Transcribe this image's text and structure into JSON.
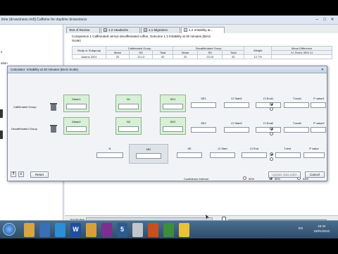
{
  "window": {
    "title": "time (drowsiness.rm5] Caffeine for daytime drowsiness"
  },
  "tree": {
    "items": [
      "",
      "",
      "",
      "s",
      "",
      "ation",
      "",
      "",
      "",
      "",
      "",
      "",
      "",
      "",
      "",
      "",
      "",
      "",
      "",
      "",
      "",
      ""
    ]
  },
  "tabs": [
    {
      "label": "Text of Review"
    },
    {
      "label": "1.2 Headache"
    },
    {
      "label": "1.1 Migraines"
    },
    {
      "label": "1.2 Irritability at..."
    }
  ],
  "background": {
    "comparison": "Comparison 1 Caffeinated versus decaffeinated coffee, Outcome 1.3 Irritability at 30 minutes (BIAS Scale)",
    "table_headers": {
      "study": "Study or Subgroup",
      "caff": "Caffeinated Group",
      "decaff": "Decaffeinated Group",
      "weight": "Weight",
      "md": "Mean Difference",
      "md_sub": "IV, Fixed, 95% CI",
      "mean": "Mean",
      "sd": "SD",
      "total": "Total"
    },
    "first_row": {
      "study": "Adams 2001",
      "mean1": "20",
      "sd1": "13.13",
      "mean2": "20",
      "sd2": "23.24",
      "total": "40",
      "weight": "12.7%"
    },
    "footnotes_label": "Footnotes"
  },
  "dialog": {
    "title": "Calculator: Irritability at 30 minutes (BIAS Scale)",
    "caffeinated_group": "Caffeinated Group",
    "decaffeinated_group": "Decaffeinated Group",
    "col_mean1": "Mean1",
    "col_n1": "N1",
    "col_sd1": "SD1",
    "col_mean2": "Mean2",
    "col_n2": "N2",
    "col_sd2": "SD2",
    "se1": "SE1",
    "ci_start1": "CI Start1",
    "ci_end1": "CI End1",
    "t_test1": "T-test1",
    "p_value1": "P value1",
    "se2": "SE2",
    "ci_start2": "CI Start2",
    "ci_end2": "CI End2",
    "t_test2": "T-test2",
    "p_value2": "P value2",
    "n": "N",
    "md": "MD",
    "se": "SE",
    "ci_start": "CI Start",
    "ci_end": "CI End",
    "t_test": "T-test",
    "p_value": "P value",
    "confidence_label": "Confidence Interval:",
    "conf_options": [
      "90%",
      "95%",
      "99%"
    ],
    "conf_selected": "95%",
    "reset_button": "Reset",
    "update_button": "Update data table",
    "cancel_button": "Cancel",
    "help_icon": "?",
    "calc_icon": "≡"
  },
  "taskbar": {
    "icons": [
      "explorer-icon",
      "media-icon",
      "ie-icon",
      "word-icon",
      "outlook-icon",
      "revman-icon",
      "app5-icon",
      "app-icon",
      "excel-icon",
      "app-icon",
      "app-icon"
    ],
    "tray_lang": "EN",
    "time": "15:42",
    "date": "18/01/2013"
  }
}
